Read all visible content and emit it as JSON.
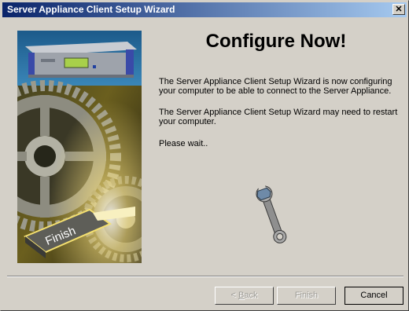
{
  "window": {
    "title": "Server Appliance Client Setup Wizard",
    "close_glyph": "✕"
  },
  "banner": {
    "finish_text": "Finish",
    "icons": [
      "server-appliance-icon",
      "gear-icon",
      "finish-key-icon"
    ]
  },
  "main": {
    "heading": "Configure Now!",
    "paragraph1": "The Server Appliance Client Setup Wizard is now configuring your computer to be able to connect to the Server Appliance.",
    "paragraph2": "The Server Appliance Client Setup Wizard may need to restart your computer.",
    "paragraph3": "Please wait..",
    "progress_icon": "wrench-icon"
  },
  "buttons": {
    "back_prefix": "< ",
    "back_hotkey": "B",
    "back_rest": "ack",
    "finish": "Finish",
    "cancel": "Cancel"
  },
  "colors": {
    "titlebar_start": "#0a246a",
    "titlebar_end": "#a6caf0",
    "dialog_face": "#d4d0c8"
  }
}
